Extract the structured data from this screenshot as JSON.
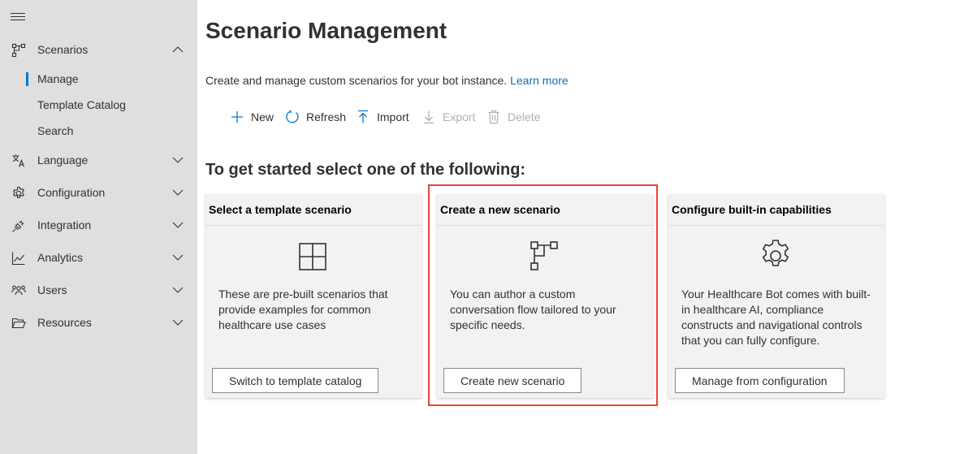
{
  "sidebar": {
    "items": [
      {
        "label": "Scenarios",
        "icon": "flow-icon",
        "expanded": true
      },
      {
        "label": "Language",
        "icon": "language-icon",
        "expanded": false
      },
      {
        "label": "Configuration",
        "icon": "gear-icon",
        "expanded": false
      },
      {
        "label": "Integration",
        "icon": "plug-icon",
        "expanded": false
      },
      {
        "label": "Analytics",
        "icon": "chart-icon",
        "expanded": false
      },
      {
        "label": "Users",
        "icon": "users-icon",
        "expanded": false
      },
      {
        "label": "Resources",
        "icon": "folder-icon",
        "expanded": false
      }
    ],
    "subitems": [
      {
        "label": "Manage",
        "active": true
      },
      {
        "label": "Template Catalog",
        "active": false
      },
      {
        "label": "Search",
        "active": false
      }
    ]
  },
  "page": {
    "title": "Scenario Management",
    "description": "Create and manage custom scenarios for your bot instance.",
    "learn_more": "Learn more",
    "section_heading": "To get started select one of the following:"
  },
  "toolbar": {
    "new_label": "New",
    "refresh_label": "Refresh",
    "import_label": "Import",
    "export_label": "Export",
    "delete_label": "Delete"
  },
  "cards": [
    {
      "title": "Select a template scenario",
      "icon": "grid-icon",
      "body": "These are pre-built scenarios that provide examples for common healthcare use cases",
      "button": "Switch to template catalog"
    },
    {
      "title": "Create a new scenario",
      "icon": "flow-icon",
      "body": "You can author a custom conversation flow tailored to your specific needs.",
      "button": "Create new scenario",
      "highlighted": true
    },
    {
      "title": "Configure built-in capabilities",
      "icon": "gear-icon",
      "body": "Your Healthcare Bot comes with built-in healthcare AI, compliance constructs and navigational controls that you can fully configure.",
      "button": "Manage from configuration"
    }
  ],
  "colors": {
    "accent": "#0078d4",
    "highlight_border": "#e8443c",
    "sidebar_bg": "#e1dfdd",
    "disabled": "#b3b0ad"
  }
}
